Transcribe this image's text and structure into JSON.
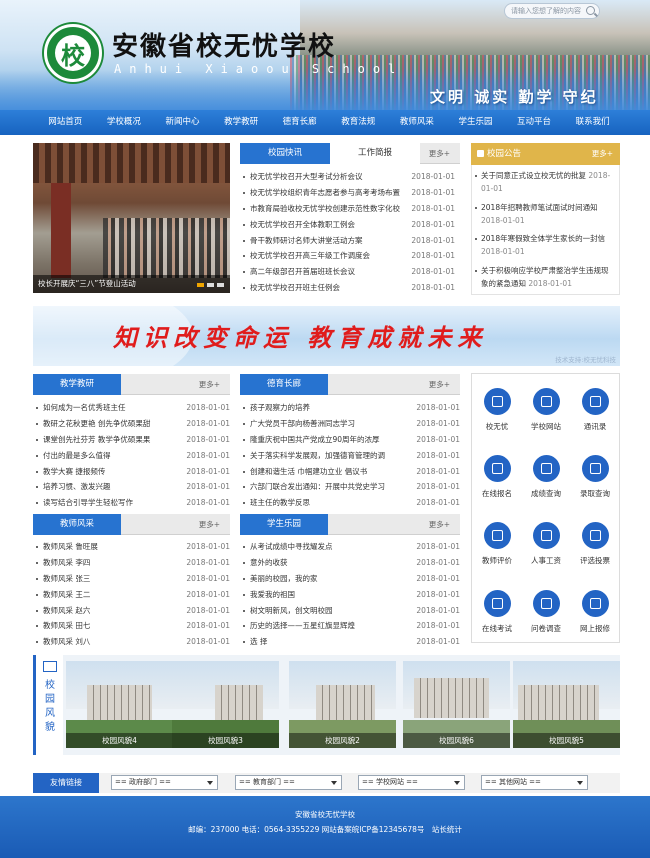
{
  "header": {
    "logo_char": "校",
    "school_name": "安徽省校无忧学校",
    "school_name_en": "Anhui Xiaoou School",
    "motto": "文明 诚实 勤学 守纪",
    "search_placeholder": "请输入您想了解的内容"
  },
  "nav": [
    "网站首页",
    "学校概况",
    "新闻中心",
    "教学教研",
    "德育长廊",
    "教育法规",
    "教师风采",
    "学生乐园",
    "互动平台",
    "联系我们"
  ],
  "slider": {
    "caption": "校长开展庆“三八”节登山活动"
  },
  "news": {
    "tabs": [
      "校园快讯",
      "工作简报"
    ],
    "more": "更多+",
    "rows": [
      {
        "t": "校无忧学校召开大型考试分析会议",
        "d": "2018-01-01"
      },
      {
        "t": "校无忧学校组织青年志愿者参与高考考场布置",
        "d": "2018-01-01"
      },
      {
        "t": "市教育局验收校无忧学校创建示范性数字化校",
        "d": "2018-01-01"
      },
      {
        "t": "校无忧学校召开全体教职工例会",
        "d": "2018-01-01"
      },
      {
        "t": "骨干教师研讨名师大讲堂活动方案",
        "d": "2018-01-01"
      },
      {
        "t": "校无忧学校召开高三年级工作调度会",
        "d": "2018-01-01"
      },
      {
        "t": "高二年级部召开首届班班长会议",
        "d": "2018-01-01"
      },
      {
        "t": "校无忧学校召开班主任例会",
        "d": "2018-01-01"
      }
    ]
  },
  "notice": {
    "title": "校园公告",
    "more": "更多+",
    "rows": [
      {
        "t": "关于同意正式设立校无忧的批复",
        "d": "2018-01-01"
      },
      {
        "t": "2018年招聘教师笔试面试时间通知",
        "d": "2018-01-01"
      },
      {
        "t": "2018年寒假致全体学生家长的一封信",
        "d": "2018-01-01"
      },
      {
        "t": "关于积极响应学校严肃整治学生违规现象的紧急通知",
        "d": "2018-01-01"
      }
    ]
  },
  "banner": {
    "text": "知识改变命运 教育成就未来",
    "credit": "技术支持:校无忧科技"
  },
  "teach": {
    "title": "教学教研",
    "more": "更多+",
    "rows": [
      {
        "t": "如何成为一名优秀班主任",
        "d": "2018-01-01"
      },
      {
        "t": "教研之花秋更艳 创先争优硕果甜",
        "d": "2018-01-01"
      },
      {
        "t": "课堂创先社芬芳 教学争优硕果果",
        "d": "2018-01-01"
      },
      {
        "t": "付出的最是多么值得",
        "d": "2018-01-01"
      },
      {
        "t": "教学大赛 捷报频传",
        "d": "2018-01-01"
      },
      {
        "t": "培养习惯、激发兴趣",
        "d": "2018-01-01"
      },
      {
        "t": "读写结合引导学生轻松写作",
        "d": "2018-01-01"
      }
    ]
  },
  "moral": {
    "title": "德育长廊",
    "more": "更多+",
    "rows": [
      {
        "t": "孩子观察力的培养",
        "d": "2018-01-01"
      },
      {
        "t": "广大党员干部向杨善洲同志学习",
        "d": "2018-01-01"
      },
      {
        "t": "隆重庆祝中国共产党成立90周年的浓厚",
        "d": "2018-01-01"
      },
      {
        "t": "关于落实科学发展观，加强德育管理的调",
        "d": "2018-01-01"
      },
      {
        "t": "创建和谐生活 巾帼建功立业 倡议书",
        "d": "2018-01-01"
      },
      {
        "t": "六部门联合发出通知：开展中共党史学习",
        "d": "2018-01-01"
      },
      {
        "t": "班主任的教学反思",
        "d": "2018-01-01"
      }
    ]
  },
  "teachers": {
    "title": "教师风采",
    "more": "更多+",
    "rows": [
      {
        "t": "教师风采 鲁旺展",
        "d": "2018-01-01"
      },
      {
        "t": "教师风采 李四",
        "d": "2018-01-01"
      },
      {
        "t": "教师风采 张三",
        "d": "2018-01-01"
      },
      {
        "t": "教师风采 王二",
        "d": "2018-01-01"
      },
      {
        "t": "教师风采 赵六",
        "d": "2018-01-01"
      },
      {
        "t": "教师风采 田七",
        "d": "2018-01-01"
      },
      {
        "t": "教师风采 刘八",
        "d": "2018-01-01"
      }
    ]
  },
  "students": {
    "title": "学生乐园",
    "more": "更多+",
    "rows": [
      {
        "t": "从考试成绩中寻找耀发点",
        "d": "2018-01-01"
      },
      {
        "t": "意外的收获",
        "d": "2018-01-01"
      },
      {
        "t": "美丽的校园，我的家",
        "d": "2018-01-01"
      },
      {
        "t": "我爱我的祖国",
        "d": "2018-01-01"
      },
      {
        "t": "树文明新风，创文明校园",
        "d": "2018-01-01"
      },
      {
        "t": "历史的选择——五星红旗显辉煌",
        "d": "2018-01-01"
      },
      {
        "t": "选 择",
        "d": "2018-01-01"
      }
    ]
  },
  "quick": [
    {
      "label": "校无忧",
      "icon": "school-badge-icon"
    },
    {
      "label": "学校网站",
      "icon": "building-icon"
    },
    {
      "label": "通讯录",
      "icon": "book-icon"
    },
    {
      "label": "在线报名",
      "icon": "form-icon"
    },
    {
      "label": "成绩查询",
      "icon": "chart-icon"
    },
    {
      "label": "录取查询",
      "icon": "list-icon"
    },
    {
      "label": "教师评价",
      "icon": "chat-icon"
    },
    {
      "label": "人事工资",
      "icon": "person-icon"
    },
    {
      "label": "评选投票",
      "icon": "vote-icon"
    },
    {
      "label": "在线考试",
      "icon": "globe-icon"
    },
    {
      "label": "问卷调查",
      "icon": "survey-icon"
    },
    {
      "label": "网上报修",
      "icon": "wrench-icon"
    }
  ],
  "scenery": {
    "title": "校园风貌",
    "photos": [
      "校园风貌4",
      "校园风貌3",
      "校园风貌2",
      "校园风貌6",
      "校园风貌5"
    ]
  },
  "links": {
    "title": "友情链接",
    "selects": [
      "== 政府部门 ==",
      "== 教育部门 ==",
      "== 学校网站 ==",
      "== 其他网站 =="
    ]
  },
  "footer": {
    "line1": "安徽省校无忧学校",
    "line2": "邮编：237000 电话：0564-3355229 网站备案皖ICP备12345678号　站长统计"
  }
}
